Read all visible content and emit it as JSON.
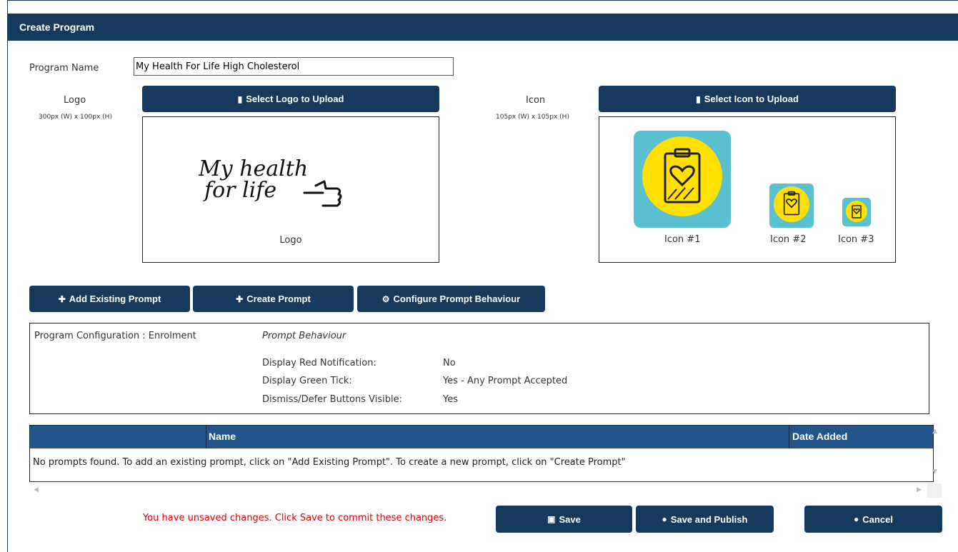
{
  "window": {
    "title": "Create Program"
  },
  "program": {
    "name_label": "Program Name",
    "name_value": "My Health For Life High Cholesterol"
  },
  "logo": {
    "label": "Logo",
    "dims": "300px (W) x 100px (H)",
    "upload_label": "Select Logo to Upload",
    "art_line1": "My health",
    "art_line2": "for life",
    "caption": "Logo"
  },
  "icon": {
    "label": "Icon",
    "dims": "105px (W) x 105px (H)",
    "upload_label": "Select Icon to Upload",
    "captions": [
      "Icon #1",
      "Icon #2",
      "Icon #3"
    ]
  },
  "actions": {
    "add_existing": "Add Existing Prompt",
    "create": "Create Prompt",
    "configure": "Configure Prompt Behaviour"
  },
  "config": {
    "heading": "Program Configuration : Enrolment",
    "behaviour_title": "Prompt Behaviour",
    "rows": [
      {
        "key": "Display Red Notification:",
        "value": "No"
      },
      {
        "key": "Display Green Tick:",
        "value": "Yes - Any Prompt Accepted"
      },
      {
        "key": "Dismiss/Defer Buttons Visible:",
        "value": "Yes"
      }
    ]
  },
  "table": {
    "columns": [
      "",
      "Name",
      "Date Added"
    ],
    "empty_message": "No prompts found. To add an existing prompt, click on \"Add Existing Prompt\". To create a new prompt, click on \"Create Prompt\""
  },
  "footer": {
    "unsaved_msg": "You have unsaved changes. Click Save to commit these changes.",
    "save": "Save",
    "save_publish": "Save and Publish",
    "cancel": "Cancel"
  },
  "colors": {
    "navy": "#163a5e",
    "table_header": "#24558a",
    "icon_bg": "#5bc0cf",
    "icon_circle": "#ffe000",
    "warning": "#e00000"
  }
}
